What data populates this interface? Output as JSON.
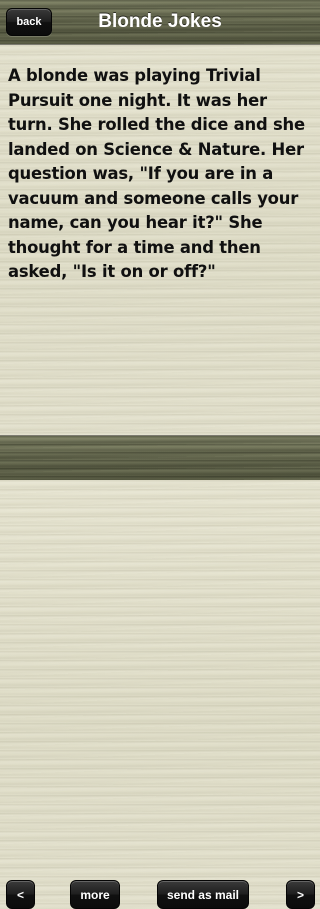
{
  "header": {
    "back_label": "back",
    "title": "Blonde Jokes"
  },
  "joke": {
    "text": "A blonde was playing Trivial Pursuit one night. It was her turn. She rolled the dice and she landed on Science & Nature. Her question was, \"If you are in a vacuum and someone calls your name, can you hear it?\" She thought for a time and then asked, \"Is it on or off?\""
  },
  "toolbar": {
    "prev_label": "<",
    "more_label": "more",
    "mail_label": "send as mail",
    "next_label": ">"
  },
  "colors": {
    "bar": "#6e7157",
    "background": "#e5e3cf",
    "button": "#1a1a1a",
    "text": "#101010"
  }
}
